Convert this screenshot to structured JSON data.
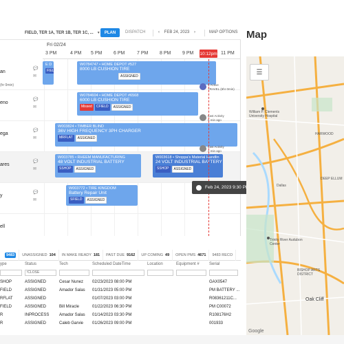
{
  "toolbar": {
    "filter_label": "FIELD, TER 1A, TER 1B, TER 1C, ...",
    "plan_label": "PLAN",
    "dispatch_label": "DISPATCH",
    "date_label": "FEB 24, 2023",
    "map_options_label": "MAP OPTIONS"
  },
  "map": {
    "title": "Map"
  },
  "schedule": {
    "day": "Fri 02/24",
    "hours": [
      "3 PM",
      "4 PM",
      "5 PM",
      "6 PM",
      "7 PM",
      "8 PM",
      "9 PM",
      "10 PM",
      "11 PM"
    ],
    "now_label": "10:12pm",
    "technicians": [
      {
        "name": "an"
      },
      {
        "name": "eno"
      },
      {
        "name": "ega"
      },
      {
        "name": "ares"
      },
      {
        "name": "y"
      },
      {
        "name": "ell"
      }
    ],
    "hint": "(hr 0min)",
    "jobs": [
      {
        "line1": "W0784747 • HOME DEPOT #527",
        "line2": "8000 LB CUSHION TIRE",
        "tags": [
          "ASSIGNED"
        ]
      },
      {
        "line1": "W0784604 • HOME DEPOT #6568",
        "line2": "6000 LB CUSHION TIRE",
        "tags": [
          "Missed",
          "CFIELD",
          "ASSIGNED"
        ]
      },
      {
        "line1": "W003824 • TIMBER BLIND",
        "line2": "36V HIGH FREQUENCY 3PH CHARGER",
        "tags": [
          "MRFLAT",
          "ASSIGNED"
        ]
      },
      {
        "line1": "W003785 • RHEEM MANUFACTURING",
        "line2": "48 VOLT INDUSTRIAL BATTERY",
        "tags": [
          "SSHOP",
          "ASSIGNED"
        ]
      },
      {
        "line1": "W003618 • Shoppa's Material Handlin",
        "line2": "24 VOLT INDUSTRIAL BATTERY",
        "tags": [
          "SSHOP",
          "ASSIGNED"
        ]
      },
      {
        "line1": "W003772 • TIRE KINGDOM",
        "line2": "Battery Repair Unit",
        "tags": [
          "SFIELD",
          "ASSIGNED"
        ]
      },
      {
        "line1": "E D",
        "line2": "",
        "tags": [
          "FIELD"
        ]
      }
    ],
    "activities": [
      {
        "line1": "6 Active",
        "line2": "TRAVEL (6hr 0min)"
      },
      {
        "line1": "Last Activity",
        "line2": "6 min ago"
      },
      {
        "line1": "Last Activity",
        "line2": "2 min ago"
      }
    ],
    "tooltip": "Feb 24, 2023 9:30 PM"
  },
  "tabs": [
    {
      "label": "",
      "count": "9483"
    },
    {
      "label": "UNASSIGNED",
      "count": "104"
    },
    {
      "label": "IN MAKE READY",
      "count": "181"
    },
    {
      "label": "PAST DUE",
      "count": "9162"
    },
    {
      "label": "UP COMING",
      "count": "49"
    },
    {
      "label": "OPEN PMS",
      "count": "4671"
    },
    {
      "label": "9483 RECO",
      "count": ""
    }
  ],
  "table": {
    "headers": [
      "ype",
      "Status",
      "Tech",
      "Scheduled DateTime",
      "Location",
      "Equipment #",
      "Serial"
    ],
    "filter_status": "!CLOSE",
    "rows": [
      [
        "SHOP",
        "ASSIGNED",
        "Cesar Nunez",
        "02/23/2023 08:00 PM",
        "",
        "",
        "GAX0547"
      ],
      [
        "FIELD",
        "ASSIGNED",
        "Amador Salas",
        "01/31/2023 05:00 PM",
        "",
        "",
        "PM BATTERY ..."
      ],
      [
        "RFLAT",
        "ASSIGNED",
        "",
        "01/07/2023 03:00 PM",
        "",
        "",
        "R08361211C..."
      ],
      [
        "FIELD",
        "ASSIGNED",
        "Bill Miracle",
        "01/22/2023 06:30 PM",
        "",
        "",
        "PM C00072"
      ],
      [
        "R",
        "INPROCESS",
        "Amador Salas",
        "01/14/2023 03:30 PM",
        "",
        "",
        "R108176H2"
      ],
      [
        "R",
        "ASSIGNED",
        "Caleb Garvie",
        "01/26/2023 09:00 PM",
        "",
        "",
        "001933"
      ]
    ]
  },
  "map_labels": [
    "William P. Clements University Hospital",
    "HARWOOD",
    "DEEP ELLUM",
    "Trinity River Audubon Center",
    "BISHOP ARTS DISTRICT",
    "Oak Cliff",
    "Dallas",
    "Google"
  ]
}
